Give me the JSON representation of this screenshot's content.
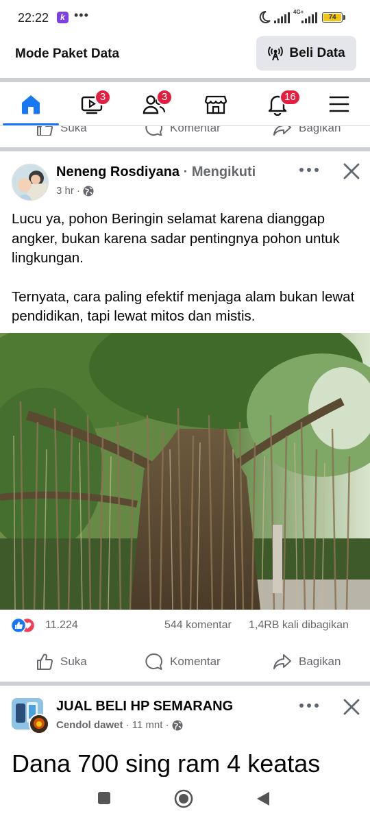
{
  "status_bar": {
    "time": "22:22",
    "app_badge": "k",
    "more": "•••",
    "network": "4G+",
    "battery": "74"
  },
  "data_banner": {
    "title": "Mode Paket Data",
    "button_label": "Beli Data"
  },
  "nav": {
    "items": [
      {
        "name": "home",
        "active": true
      },
      {
        "name": "video",
        "badge": "3"
      },
      {
        "name": "friends",
        "badge": "3"
      },
      {
        "name": "marketplace"
      },
      {
        "name": "notifications",
        "badge": "16"
      },
      {
        "name": "menu"
      }
    ]
  },
  "actions": {
    "like": "Suka",
    "comment": "Komentar",
    "share": "Bagikan"
  },
  "post": {
    "author": "Neneng Rosdiyana",
    "follow_status": "· Mengikuti",
    "time": "3 hr ·",
    "paragraphs": [
      "Lucu ya, pohon Beringin selamat karena dianggap angker, bukan karena sadar pentingnya pohon untuk lingkungan.",
      "Ternyata, cara paling efektif menjaga alam bukan lewat pendidikan, tapi lewat mitos dan mistis."
    ],
    "reactions_count": "11.224",
    "comments_count": "544 komentar",
    "shares_count": "1,4RB kali dibagikan"
  },
  "post2": {
    "group": "JUAL BELI HP SEMARANG",
    "sub_author": "Cendol dawet",
    "time": "· 11 mnt ·",
    "text": "Dana 700 sing ram 4 keatas"
  },
  "colors": {
    "accent": "#1877f2",
    "badge": "#e41e3f",
    "secondary_text": "#65676b",
    "separator": "#ccd0d5"
  }
}
